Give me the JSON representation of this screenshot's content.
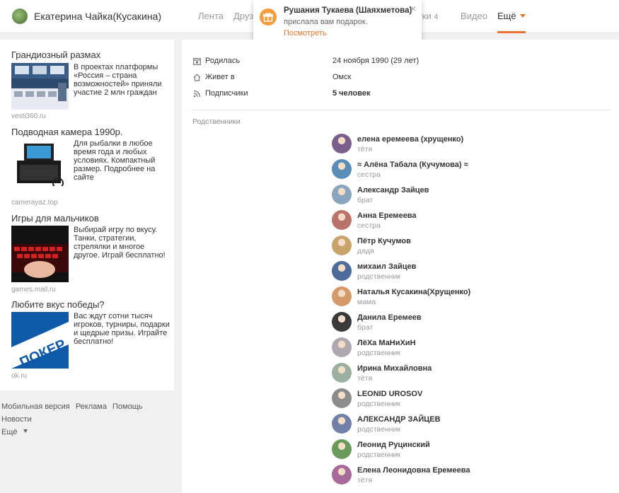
{
  "header": {
    "user_name": "Екатерина Чайка(Кусакина)",
    "nav": [
      {
        "label": "Лента",
        "count": ""
      },
      {
        "label": "Друзья",
        "count": ""
      },
      {
        "label": "Заметки",
        "count": "4"
      },
      {
        "label": "Видео",
        "count": ""
      }
    ],
    "more_label": "Ещё"
  },
  "notification": {
    "title": "Рушания Тукаева (Шаяхметова)",
    "text": "прислала вам подарок.",
    "link": "Посмотреть",
    "close": "×",
    "icon": "gift-icon"
  },
  "ads": [
    {
      "title": "Грандиозный размах",
      "text": "В проектах платформы «Россия – страна возможностей» приняли участие 2 млн граждан",
      "source": "vesti360.ru"
    },
    {
      "title": "Подводная камера 1990р.",
      "text": "Для рыбалки в любое время года и любых условиях. Компактный размер. Подробнее на сайте",
      "source": "camerayaz.top"
    },
    {
      "title": "Игры для мальчиков",
      "text": "Выбирай игру по вкусу. Танки, стратегии, стрелялки и многое другое. Играй бесплатно!",
      "source": "games.mail.ru",
      "image_caption": "Игры для мальчиков"
    },
    {
      "title": "Любите вкус победы?",
      "text": "Вас ждут сотни тысяч игроков, турниры, подарки и щедрые призы. Играйте бесплатно!",
      "source": "ok.ru",
      "image_caption": "ПОКЕР"
    }
  ],
  "footer": {
    "links": [
      "Мобильная версия",
      "Реклама",
      "Помощь",
      "Новости"
    ],
    "more": "Ещё"
  },
  "profile": {
    "info": [
      {
        "icon": "calendar-icon",
        "label": "Родилась",
        "value": "24 ноября 1990 (29 лет)",
        "bold": false
      },
      {
        "icon": "home-icon",
        "label": "Живет в",
        "value": "Омск",
        "bold": false
      },
      {
        "icon": "rss-icon",
        "label": "Подписчики",
        "value": "5 человек",
        "bold": true
      }
    ],
    "relatives_title": "Родственники",
    "relatives": [
      {
        "name": "елена еремеева (хрущенко)",
        "role": "тётя",
        "color": "#7a5f8c"
      },
      {
        "name": "≈ Алёна Табала (Кучумова) ≈",
        "role": "сестра",
        "color": "#5a8db8"
      },
      {
        "name": "Александр Зайцев",
        "role": "брат",
        "color": "#8aa6bf"
      },
      {
        "name": "Анна Еремеева",
        "role": "сестра",
        "color": "#b8746a"
      },
      {
        "name": "Пётр Кучумов",
        "role": "дядя",
        "color": "#c8a36a"
      },
      {
        "name": "михаил Зайцев",
        "role": "родственник",
        "color": "#4c6a9a"
      },
      {
        "name": "Наталья Кусакина(Хрущенко)",
        "role": "мама",
        "color": "#d49a6a"
      },
      {
        "name": "Данила Еремеев",
        "role": "брат",
        "color": "#3a3a3a"
      },
      {
        "name": "ЛёХа МаНиХиН",
        "role": "родственник",
        "color": "#b0a8b0"
      },
      {
        "name": "Ирина Михайловна",
        "role": "тётя",
        "color": "#9ab0a0"
      },
      {
        "name": "LEONID UROSOV",
        "role": "родственник",
        "color": "#8c8c8c"
      },
      {
        "name": "АЛЕКСАНДР ЗАЙЦЕВ",
        "role": "родственник",
        "color": "#7080a8"
      },
      {
        "name": "Леонид Руцинский",
        "role": "родственник",
        "color": "#6a9a5a"
      },
      {
        "name": "Елена Леонидовна Еремеева",
        "role": "тётя",
        "color": "#a86a9a"
      }
    ]
  }
}
